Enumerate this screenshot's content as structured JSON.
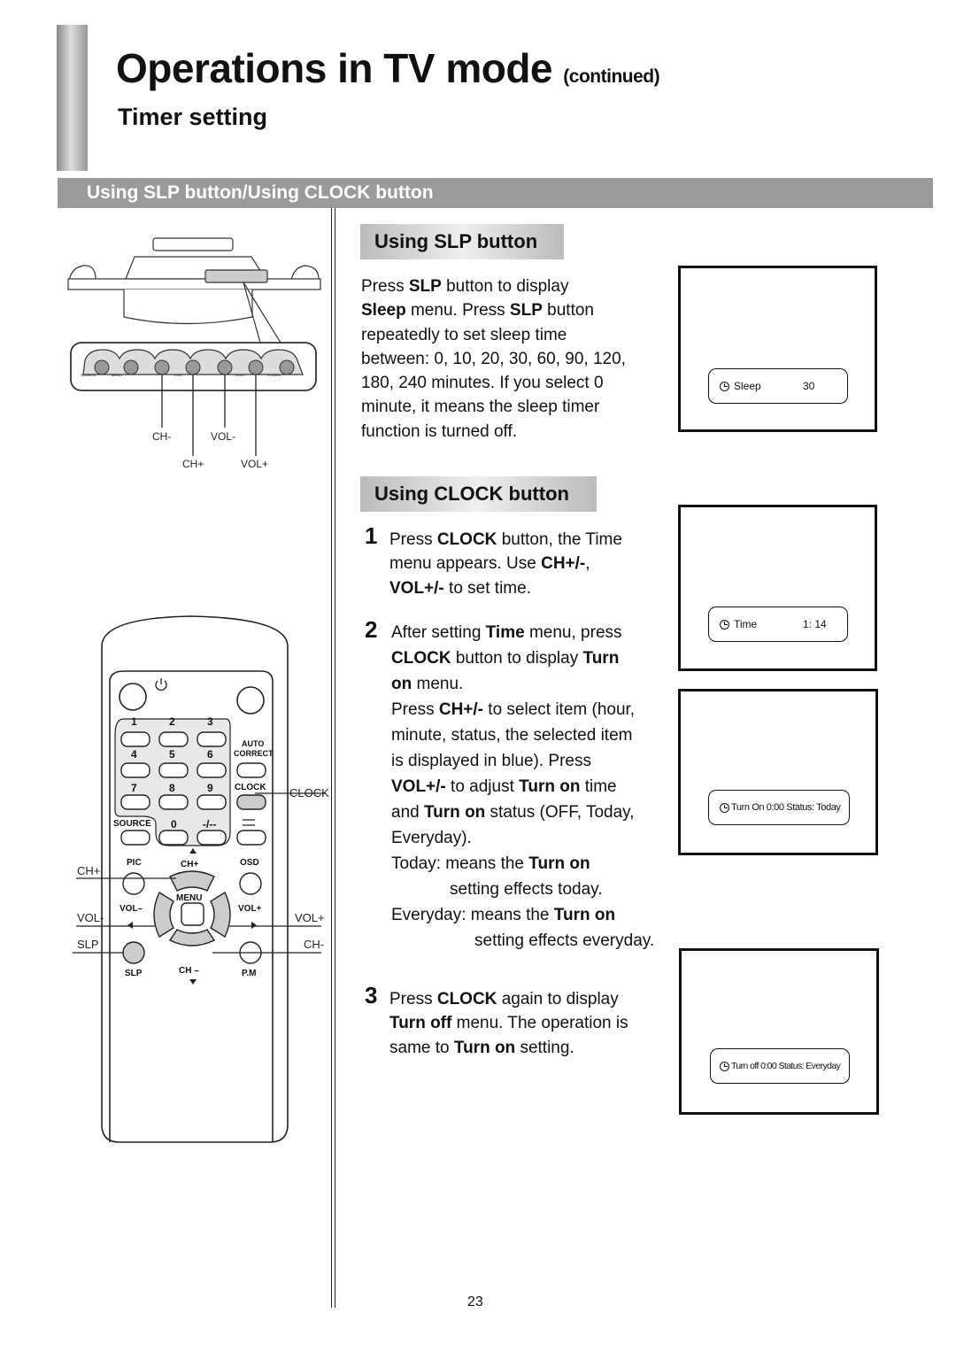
{
  "header": {
    "title": "Operations in TV mode",
    "title_suffix": "(continued)",
    "subtitle": "Timer setting",
    "section_bar": "Using SLP button/Using CLOCK button"
  },
  "tv_panel": {
    "button_labels": [
      "SOURCE",
      "MENU",
      "–CH+",
      "–VOL+",
      "POWER"
    ],
    "callouts": [
      "CH-",
      "VOL-",
      "CH+",
      "VOL+"
    ]
  },
  "remote": {
    "keypad": [
      "1",
      "2",
      "3",
      "4",
      "5",
      "6",
      "7",
      "8",
      "9",
      "0",
      "-/--"
    ],
    "labels": {
      "auto": "AUTO",
      "correct": "CORRECT",
      "clock": "CLOCK",
      "source": "SOURCE",
      "pic": "PIC",
      "ch_plus": "CH+",
      "osd": "OSD",
      "menu": "MENU",
      "vol_minus": "VOL–",
      "vol_plus": "VOL+",
      "slp": "SLP",
      "ch_minus": "CH –",
      "pm": "P.M"
    },
    "callouts": {
      "clock": "CLOCK",
      "ch_plus": "CH+",
      "vol_minus": "VOL-",
      "slp": "SLP",
      "vol_plus": "VOL+",
      "ch_minus": "CH-"
    }
  },
  "slp_section": {
    "heading": "Using SLP button",
    "paragraph": [
      [
        "Press ",
        "SLP",
        " button to display"
      ],
      [
        "",
        "Sleep",
        " menu. Press ",
        "SLP",
        " button"
      ],
      [
        "repeatedly to set sleep time"
      ],
      [
        "between: 0, 10, 20, 30, 60, 90, 120,"
      ],
      [
        "180, 240 minutes. If you select 0"
      ],
      [
        "minute, it means the sleep timer"
      ],
      [
        "function is turned off."
      ]
    ],
    "osd": {
      "label": "Sleep",
      "value": "30"
    }
  },
  "clock_section": {
    "heading": "Using CLOCK button",
    "steps": [
      {
        "num": "1"
      },
      {
        "num": "2"
      },
      {
        "num": "3"
      }
    ],
    "osd_time": {
      "label": "Time",
      "value": "1: 14"
    },
    "osd_turn_on": {
      "text": "Turn On 0:00 Status: Today"
    },
    "osd_turn_off": {
      "text": "Turn off 0:00 Status: Everyday"
    }
  },
  "page_number": "23"
}
